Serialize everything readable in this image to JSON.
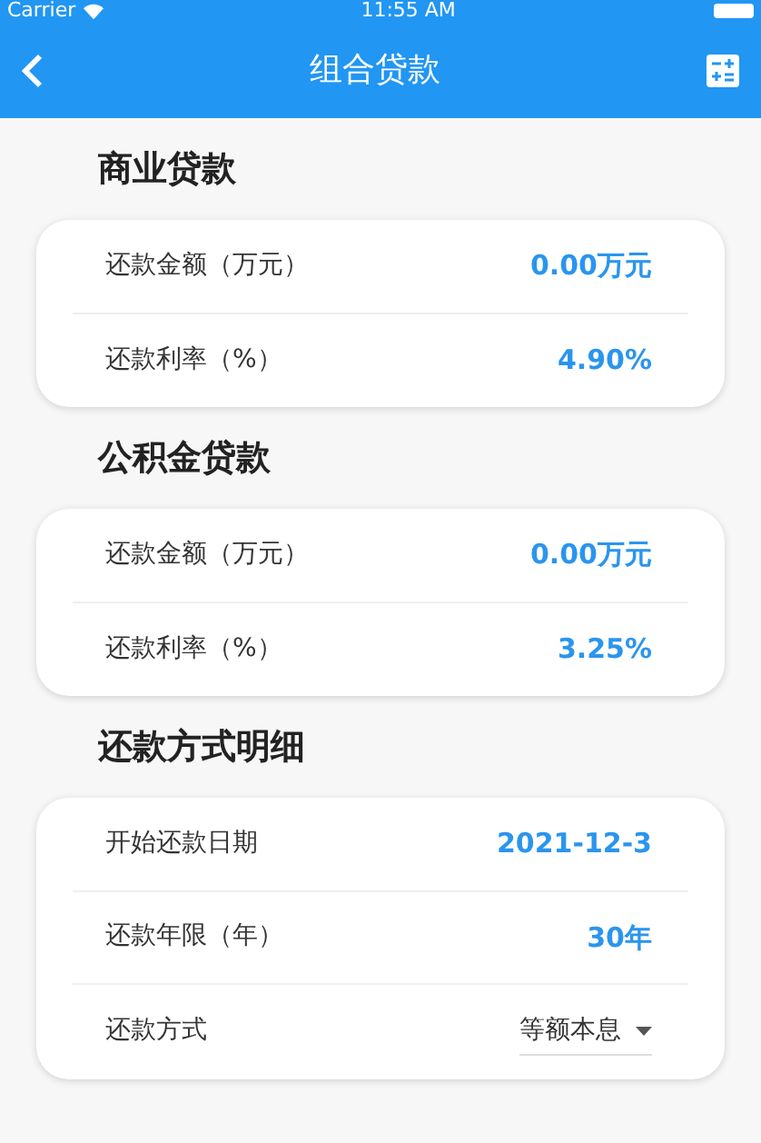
{
  "status_bar": {
    "carrier": "Carrier",
    "time": "11:55 AM"
  },
  "app_bar": {
    "title": "组合贷款"
  },
  "sections": [
    {
      "title": "商业贷款",
      "rows": [
        {
          "kind": "value",
          "label": "还款金额（万元）",
          "value": "0.00万元"
        },
        {
          "kind": "value",
          "label": "还款利率（%）",
          "value": "4.90%"
        }
      ]
    },
    {
      "title": "公积金贷款",
      "rows": [
        {
          "kind": "value",
          "label": "还款金额（万元）",
          "value": "0.00万元"
        },
        {
          "kind": "value",
          "label": "还款利率（%）",
          "value": "3.25%"
        }
      ]
    },
    {
      "title": "还款方式明细",
      "rows": [
        {
          "kind": "value",
          "label": "开始还款日期",
          "value": "2021-12-3"
        },
        {
          "kind": "value",
          "label": "还款年限（年）",
          "value": "30年"
        },
        {
          "kind": "dropdown",
          "label": "还款方式",
          "value": "等额本息"
        }
      ]
    }
  ]
}
